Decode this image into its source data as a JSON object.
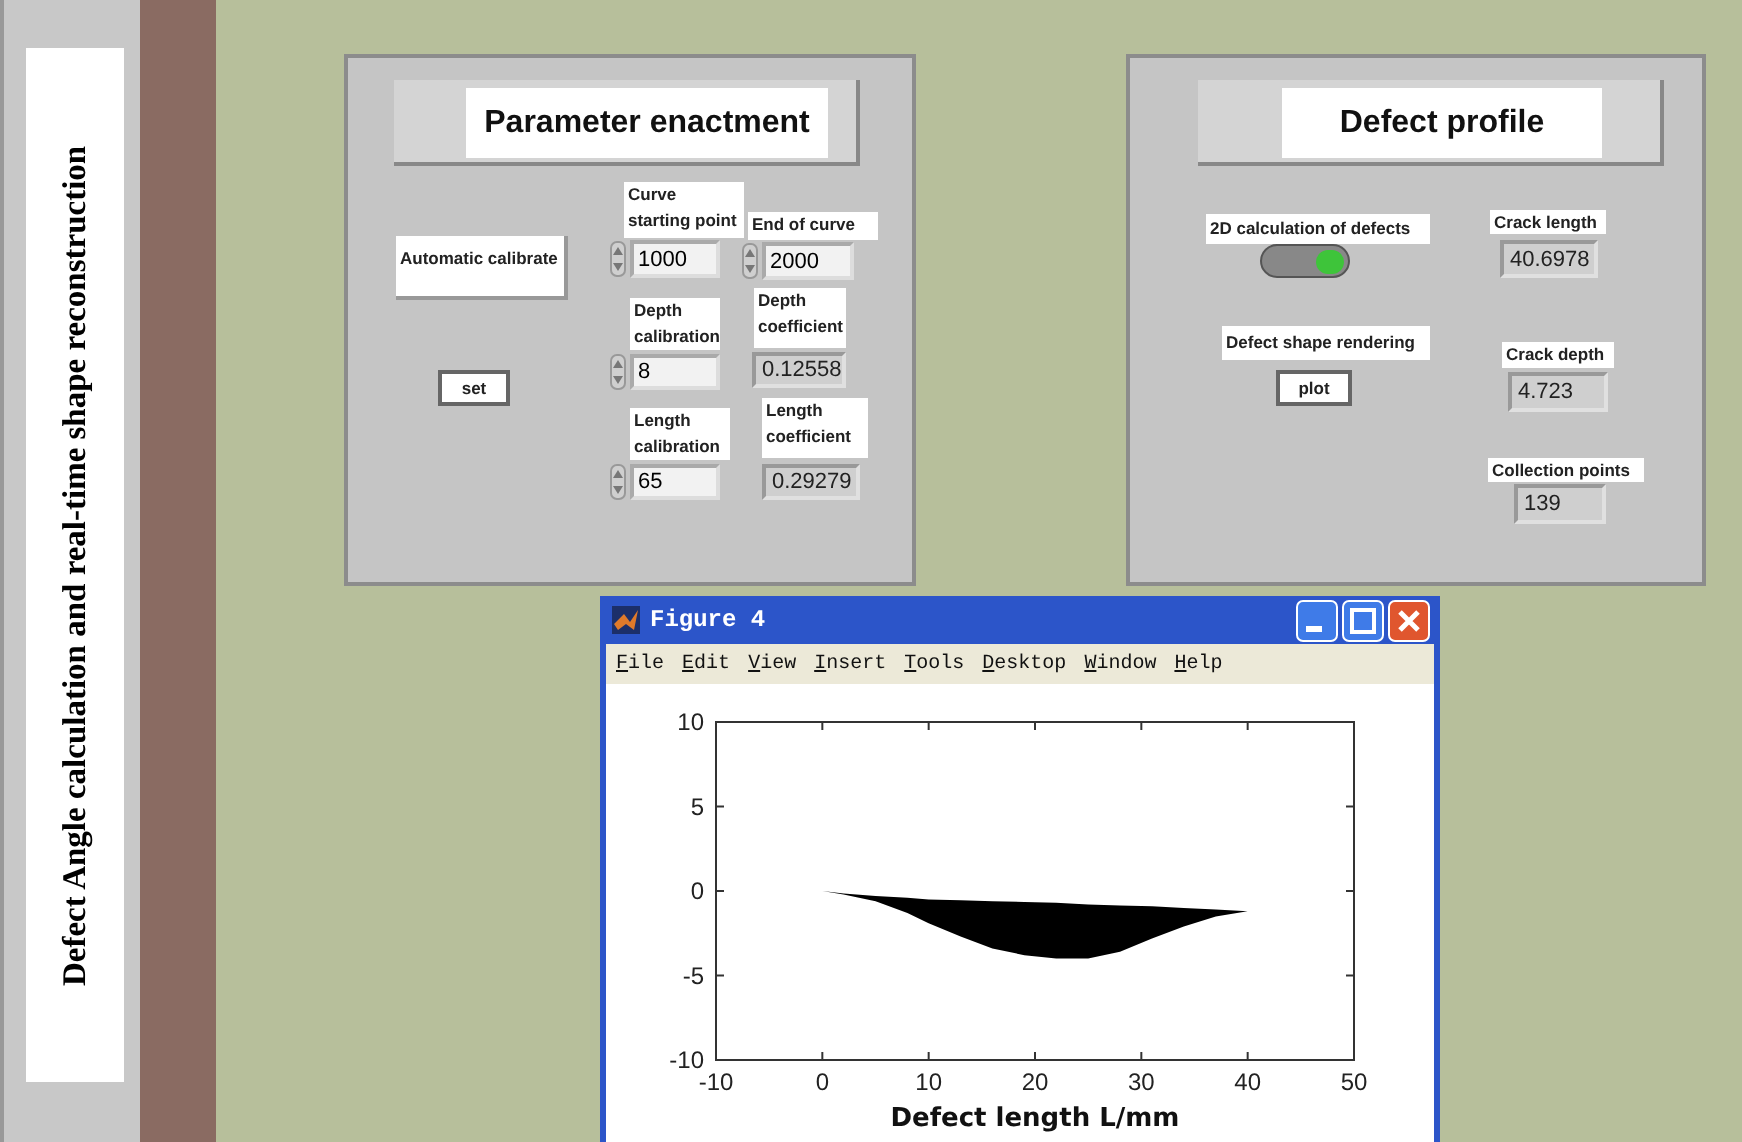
{
  "side_title": "Defect Angle calculation and real-time shape reconstruction",
  "parameter_panel": {
    "title": "Parameter enactment",
    "calibrate_label": "Automatic calibrate",
    "set_button": "set",
    "fields": [
      {
        "kind": "spinner",
        "label": "Curve starting point",
        "value": "1000"
      },
      {
        "kind": "spinner",
        "label": "End of curve",
        "value": "2000"
      },
      {
        "kind": "spinner",
        "label": "Depth calibration",
        "value": "8"
      },
      {
        "kind": "indicator",
        "label": "Depth coefficient",
        "value": "0.12558"
      },
      {
        "kind": "spinner",
        "label": "Length calibration",
        "value": "65"
      },
      {
        "kind": "indicator",
        "label": "Length coefficient",
        "value": "0.29279"
      }
    ]
  },
  "defect_panel": {
    "title": "Defect profile",
    "toggle": {
      "label": "2D calculation of defects",
      "on": true
    },
    "render": {
      "label": "Defect shape rendering",
      "button": "plot"
    },
    "readouts": [
      {
        "label": "Crack length",
        "value": "40.6978"
      },
      {
        "label": "Crack depth",
        "value": "4.723"
      },
      {
        "label": "Collection points",
        "value": "139"
      }
    ]
  },
  "figure": {
    "title": "Figure 4",
    "menu": [
      "File",
      "Edit",
      "View",
      "Insert",
      "Tools",
      "Desktop",
      "Window",
      "Help"
    ],
    "chart_data": {
      "type": "area",
      "xlabel": "Defect length L/mm",
      "xlim": [
        -10,
        50
      ],
      "ylim": [
        -10,
        10
      ],
      "xticks": [
        -10,
        0,
        10,
        20,
        30,
        40,
        50
      ],
      "yticks": [
        -10,
        -5,
        0,
        5,
        10
      ]
    }
  }
}
